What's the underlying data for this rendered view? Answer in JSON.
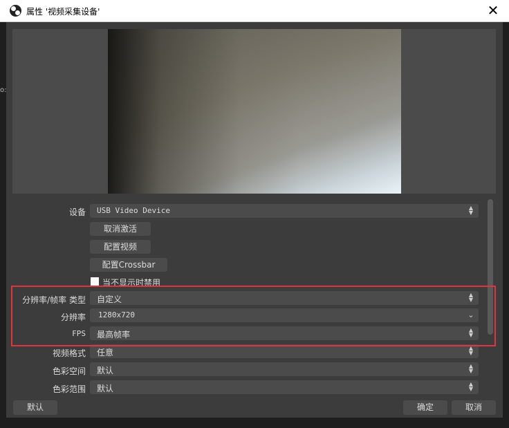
{
  "window": {
    "title": "属性 '视频采集设备'",
    "close_glyph": "✕",
    "background_fragment": "o:"
  },
  "properties": {
    "device": {
      "label": "设备",
      "value": "USB Video Device"
    },
    "buttons": {
      "deactivate": "取消激活",
      "configure_video": "配置视频",
      "configure_crossbar": "配置Crossbar"
    },
    "deactivate_when_hidden": {
      "label": "当不显示时禁用",
      "checked": false
    },
    "resolution_fps_type": {
      "label": "分辨率/帧率 类型",
      "value": "自定义"
    },
    "resolution": {
      "label": "分辨率",
      "value": "1280x720"
    },
    "fps": {
      "label": "FPS",
      "value": "最高帧率"
    },
    "video_format": {
      "label": "视频格式",
      "value": "任意"
    },
    "color_space": {
      "label": "色彩空间",
      "value": "默认"
    },
    "color_range": {
      "label": "色彩范围",
      "value": "默认"
    }
  },
  "footer": {
    "defaults": "默认",
    "ok": "确定",
    "cancel": "取消"
  },
  "colors": {
    "highlight": "#e0353c",
    "panel": "#3c3c3c",
    "control": "#4b4b4b"
  }
}
